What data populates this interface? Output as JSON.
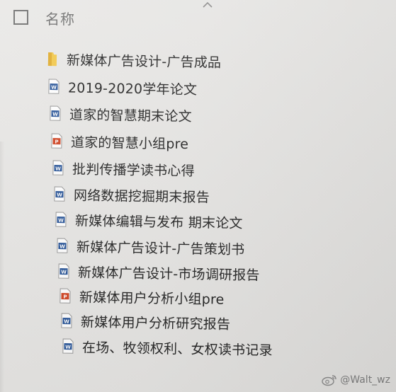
{
  "header": {
    "column_name": "名称"
  },
  "files": [
    {
      "type": "folder",
      "name": "新媒体广告设计-广告成品"
    },
    {
      "type": "word",
      "name": "2019-2020学年论文"
    },
    {
      "type": "word",
      "name": "道家的智慧期末论文"
    },
    {
      "type": "ppt",
      "name": "道家的智慧小组pre"
    },
    {
      "type": "word",
      "name": "批判传播学读书心得"
    },
    {
      "type": "word",
      "name": "网络数据挖掘期末报告"
    },
    {
      "type": "word",
      "name": "新媒体编辑与发布 期末论文"
    },
    {
      "type": "word",
      "name": "新媒体广告设计-广告策划书"
    },
    {
      "type": "word",
      "name": "新媒体广告设计-市场调研报告"
    },
    {
      "type": "ppt",
      "name": "新媒体用户分析小组pre"
    },
    {
      "type": "word",
      "name": "新媒体用户分析研究报告"
    },
    {
      "type": "word",
      "name": "在场、牧领权利、女权读书记录"
    }
  ],
  "watermark": {
    "text": "@Walt_wz"
  },
  "colors": {
    "folder": "#f2c84b",
    "word": "#2b579a",
    "ppt": "#d24726"
  }
}
